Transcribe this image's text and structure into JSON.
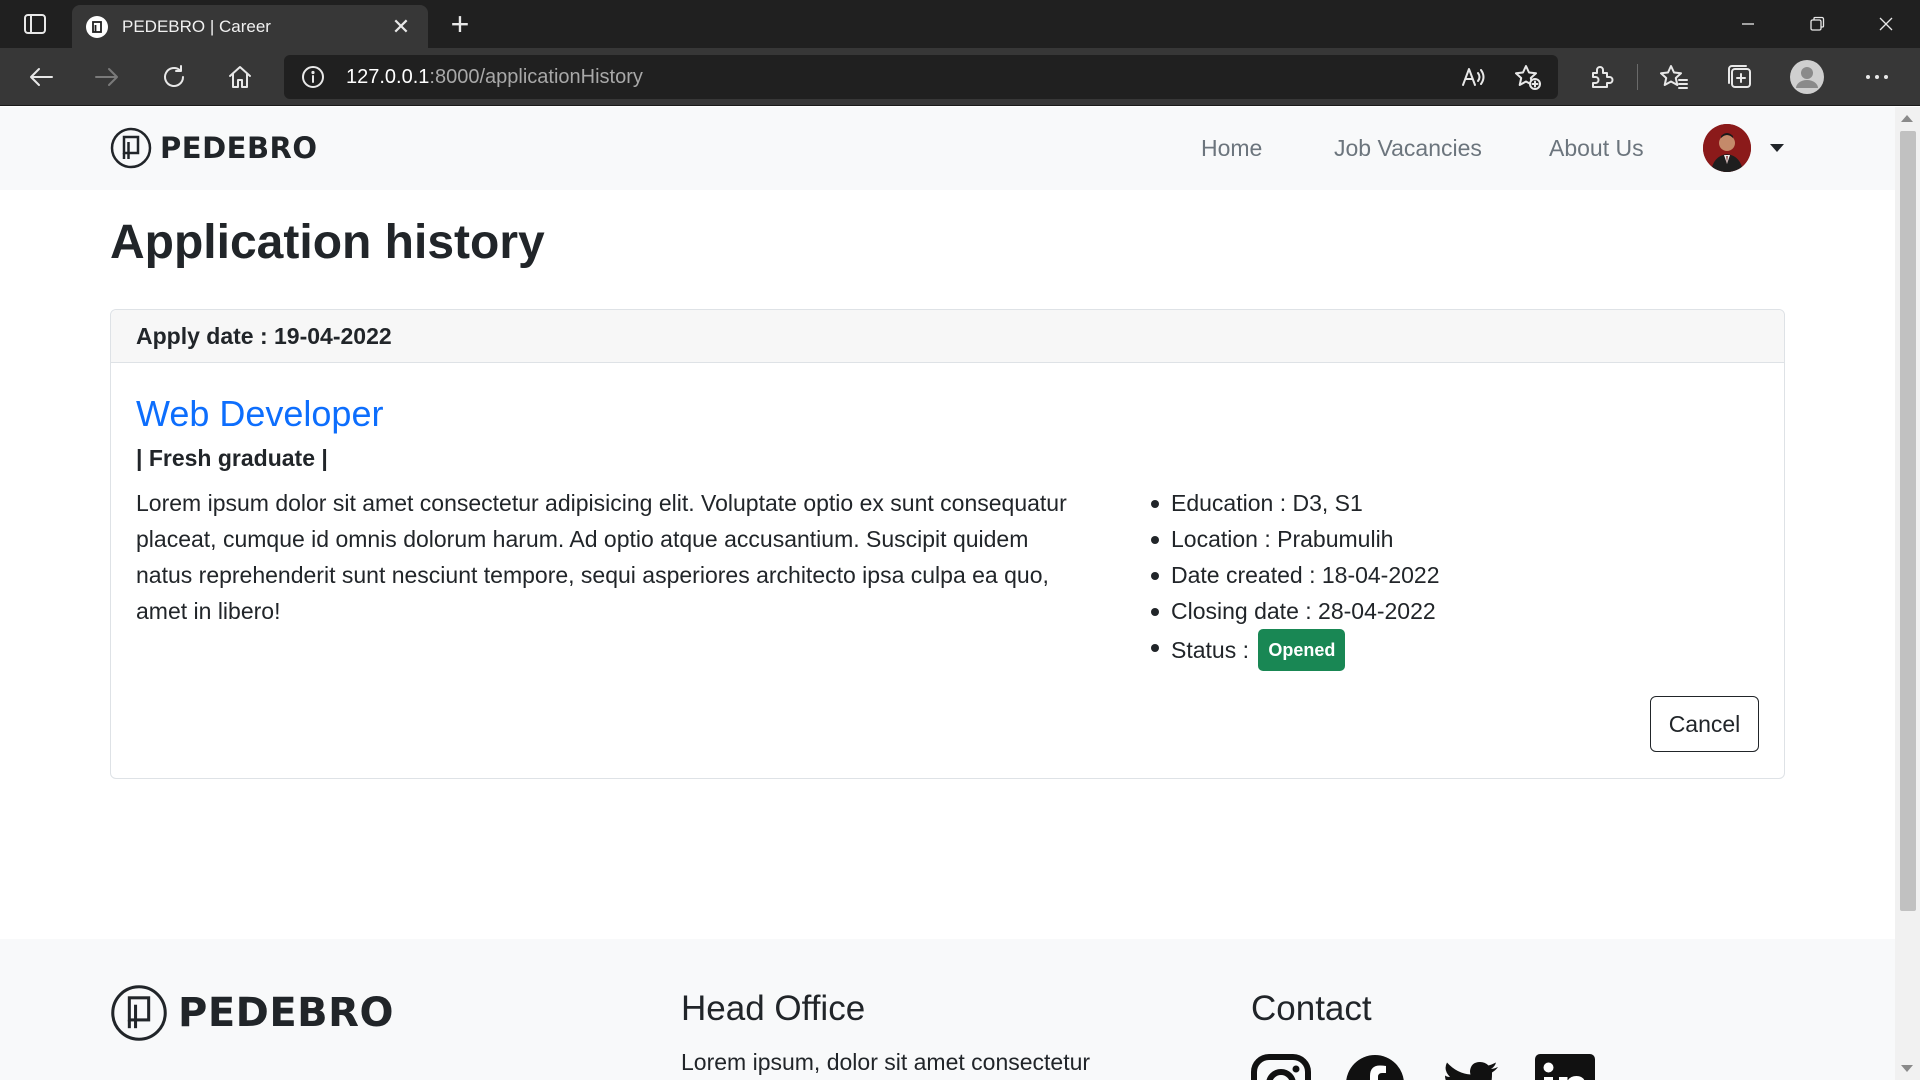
{
  "browser": {
    "tab_title": "PEDEBRO | Career",
    "url_host": "127.0.0.1",
    "url_path": ":8000/applicationHistory"
  },
  "navbar": {
    "brand": "PEDEBRO",
    "links": [
      "Home",
      "Job Vacancies",
      "About Us"
    ]
  },
  "page": {
    "title": "Application history"
  },
  "application": {
    "apply_date": "Apply date : 19-04-2022",
    "job_title": "Web Developer",
    "job_type": "| Fresh graduate |",
    "description": "Lorem ipsum dolor sit amet consectetur adipisicing elit. Voluptate optio ex sunt consequatur placeat, cumque id omnis dolorum harum. Ad optio atque accusantium. Suscipit quidem natus reprehenderit sunt nesciunt tempore, sequi asperiores architecto ipsa culpa ea quo, amet in libero!",
    "details": {
      "education": "Education : D3, S1",
      "location": "Location : Prabumulih",
      "date_created": "Date created : 18-04-2022",
      "closing_date": "Closing date : 28-04-2022",
      "status_label": "Status :",
      "status_value": "Opened"
    },
    "cancel_label": "Cancel",
    "status_color": "#198754"
  },
  "footer": {
    "brand": "PEDEBRO",
    "head_office_title": "Head Office",
    "head_office_text": "Lorem ipsum, dolor sit amet consectetur",
    "contact_title": "Contact",
    "social_icons": [
      "instagram-icon",
      "facebook-icon",
      "twitter-icon",
      "linkedin-icon"
    ]
  },
  "colors": {
    "link_blue": "#0d6efd",
    "navbar_bg": "#f8f9fa"
  }
}
